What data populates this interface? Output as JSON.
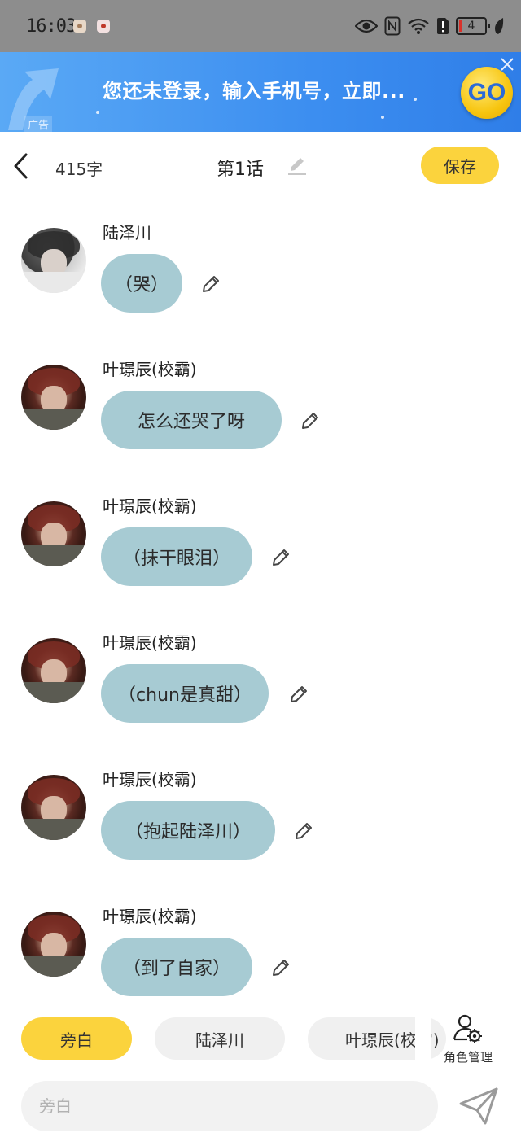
{
  "status_bar": {
    "time": "16:03",
    "battery_level": "4"
  },
  "ad": {
    "text": "您还未登录，输入手机号，立即...",
    "tag": "广告",
    "go_label": "GO"
  },
  "header": {
    "word_count": "415字",
    "chapter_title": "第1话",
    "save_label": "保存"
  },
  "messages": [
    {
      "speaker": "陆泽川",
      "text": "（哭）"
    },
    {
      "speaker": "叶璟辰(校霸)",
      "text": "怎么还哭了呀"
    },
    {
      "speaker": "叶璟辰(校霸)",
      "text": "（抹干眼泪）"
    },
    {
      "speaker": "叶璟辰(校霸)",
      "text": "（chun是真甜）"
    },
    {
      "speaker": "叶璟辰(校霸)",
      "text": "（抱起陆泽川）"
    },
    {
      "speaker": "叶璟辰(校霸)",
      "text": "（到了自家）"
    }
  ],
  "roles": {
    "chips": [
      "旁白",
      "陆泽川",
      "叶璟辰(校霸)"
    ],
    "active_index": 0,
    "manage_label": "角色管理"
  },
  "input": {
    "placeholder": "旁白"
  },
  "colors": {
    "accent_yellow": "#fbd33d",
    "bubble_blue": "#a7cbd3",
    "ad_blue": "#3c8ef0"
  }
}
